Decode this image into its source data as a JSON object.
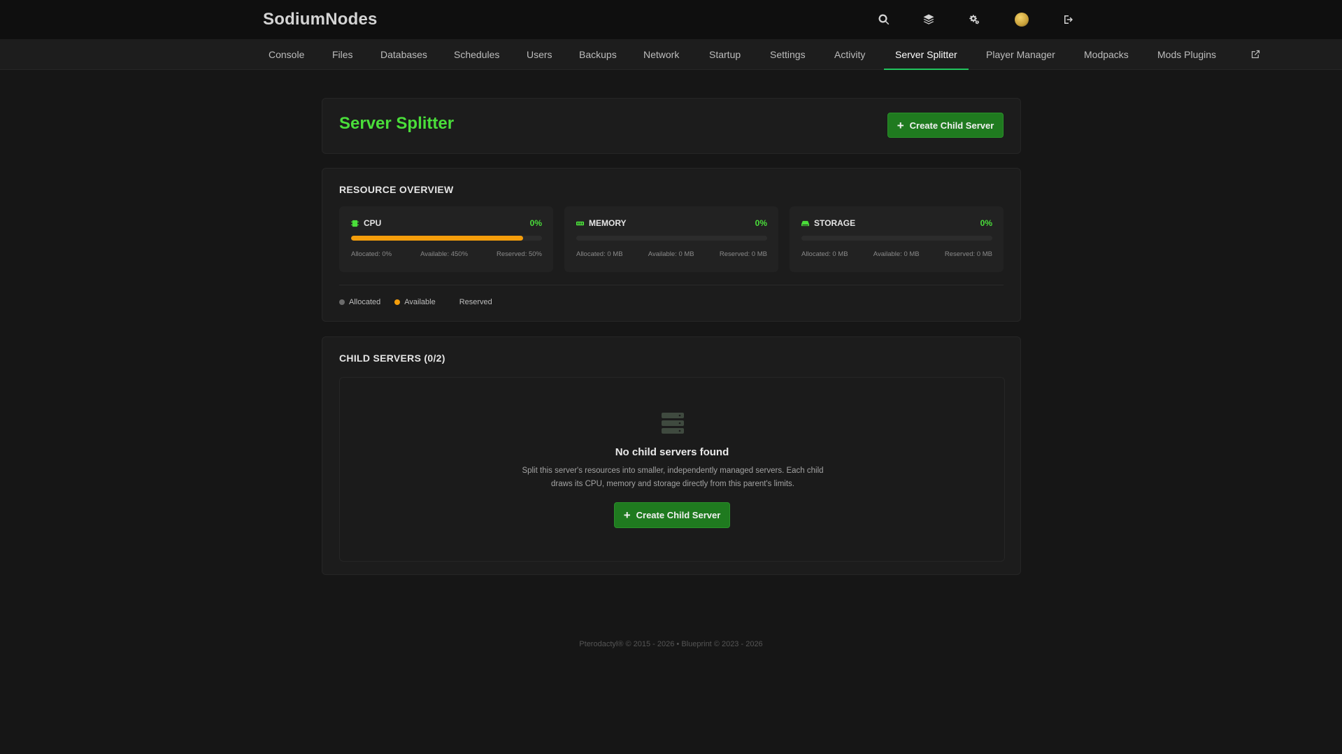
{
  "app": {
    "brand": "SodiumNodes"
  },
  "topbar": {
    "icons": [
      "search-icon",
      "layers-icon",
      "cogs-icon",
      "avatar",
      "logout-icon"
    ]
  },
  "nav": {
    "items": [
      {
        "label": "Console"
      },
      {
        "label": "Files"
      },
      {
        "label": "Databases"
      },
      {
        "label": "Schedules"
      },
      {
        "label": "Users"
      },
      {
        "label": "Backups"
      },
      {
        "label": "Network"
      },
      {
        "label": "Startup"
      },
      {
        "label": "Settings"
      },
      {
        "label": "Activity"
      },
      {
        "label": "Server Splitter",
        "active": true
      },
      {
        "label": "Player Manager"
      },
      {
        "label": "Modpacks"
      },
      {
        "label": "Mods Plugins"
      }
    ],
    "external_icon": "external-link-icon"
  },
  "header": {
    "title": "Server Splitter",
    "create_button": "Create Child Server"
  },
  "resources": {
    "title": "RESOURCE OVERVIEW",
    "cards": [
      {
        "name": "CPU",
        "icon": "cpu-icon",
        "percent": "0%",
        "available_fill": 0.9,
        "allocated": "Allocated: 0%",
        "available": "Available: 450%",
        "reserved": "Reserved: 50%"
      },
      {
        "name": "MEMORY",
        "icon": "memory-icon",
        "percent": "0%",
        "available_fill": 0,
        "allocated": "Allocated: 0 MB",
        "available": "Available: 0 MB",
        "reserved": "Reserved: 0 MB"
      },
      {
        "name": "STORAGE",
        "icon": "storage-icon",
        "percent": "0%",
        "available_fill": 0,
        "allocated": "Allocated: 0 MB",
        "available": "Available: 0 MB",
        "reserved": "Reserved: 0 MB"
      }
    ],
    "legend": {
      "allocated": "Allocated",
      "available": "Available",
      "reserved": "Reserved"
    }
  },
  "children": {
    "title": "CHILD SERVERS (0/2)",
    "empty_title": "No child servers found",
    "empty_desc": "Split this server's resources into smaller, independently managed servers. Each child draws its CPU, memory and storage directly from this parent's limits.",
    "create_button": "Create Child Server"
  },
  "footer": {
    "text": "Pterodactyl® © 2015 - 2026  •  Blueprint © 2023 - 2026"
  },
  "colors": {
    "accent": "#4ade3a",
    "button": "#1f7a1f",
    "available": "#f59e0b",
    "allocated": "#6b6b6b"
  }
}
